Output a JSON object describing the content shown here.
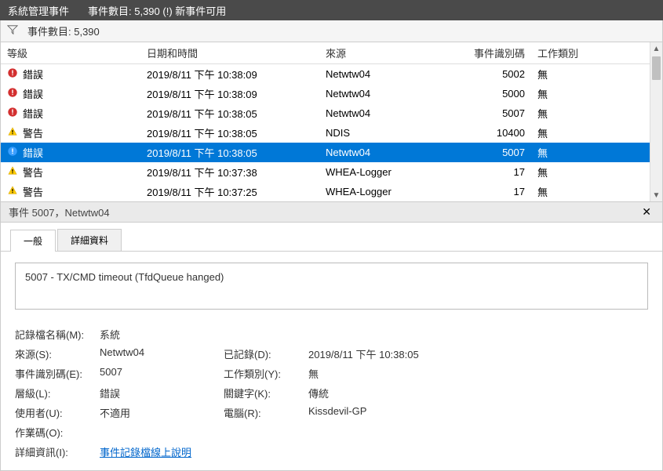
{
  "titlebar": {
    "title": "系統管理事件",
    "subtitle": "事件數目: 5,390 (!) 新事件可用"
  },
  "filterbar": {
    "text": "事件數目: 5,390"
  },
  "columns": {
    "level": "等級",
    "datetime": "日期和時間",
    "source": "來源",
    "eventid": "事件識別碼",
    "category": "工作類別"
  },
  "events": [
    {
      "icon": "error",
      "level": "錯誤",
      "datetime": "2019/8/11 下午 10:38:09",
      "source": "Netwtw04",
      "eventid": "5002",
      "category": "無",
      "selected": false
    },
    {
      "icon": "error",
      "level": "錯誤",
      "datetime": "2019/8/11 下午 10:38:09",
      "source": "Netwtw04",
      "eventid": "5000",
      "category": "無",
      "selected": false
    },
    {
      "icon": "error",
      "level": "錯誤",
      "datetime": "2019/8/11 下午 10:38:05",
      "source": "Netwtw04",
      "eventid": "5007",
      "category": "無",
      "selected": false
    },
    {
      "icon": "warning",
      "level": "警告",
      "datetime": "2019/8/11 下午 10:38:05",
      "source": "NDIS",
      "eventid": "10400",
      "category": "無",
      "selected": false
    },
    {
      "icon": "error-blue",
      "level": "錯誤",
      "datetime": "2019/8/11 下午 10:38:05",
      "source": "Netwtw04",
      "eventid": "5007",
      "category": "無",
      "selected": true
    },
    {
      "icon": "warning",
      "level": "警告",
      "datetime": "2019/8/11 下午 10:37:38",
      "source": "WHEA-Logger",
      "eventid": "17",
      "category": "無",
      "selected": false
    },
    {
      "icon": "warning",
      "level": "警告",
      "datetime": "2019/8/11 下午 10:37:25",
      "source": "WHEA-Logger",
      "eventid": "17",
      "category": "無",
      "selected": false
    }
  ],
  "detail": {
    "header": "事件 5007，Netwtw04",
    "tabs": {
      "general": "一般",
      "details": "詳細資料"
    },
    "message": "5007 - TX/CMD timeout (TfdQueue hanged)",
    "props": {
      "logname_label": "記錄檔名稱(M):",
      "logname": "系統",
      "source_label": "來源(S):",
      "source": "Netwtw04",
      "logged_label": "已記錄(D):",
      "logged": "2019/8/11 下午 10:38:05",
      "eventid_label": "事件識別碼(E):",
      "eventid": "5007",
      "category_label": "工作類別(Y):",
      "category": "無",
      "level_label": "層級(L):",
      "level": "錯誤",
      "keywords_label": "關鍵字(K):",
      "keywords": "傳統",
      "user_label": "使用者(U):",
      "user": "不適用",
      "computer_label": "電腦(R):",
      "computer": "Kissdevil-GP",
      "opcode_label": "作業碼(O):",
      "opcode": "",
      "moreinfo_label": "詳細資訊(I):",
      "moreinfo": "事件記錄檔線上說明"
    }
  }
}
